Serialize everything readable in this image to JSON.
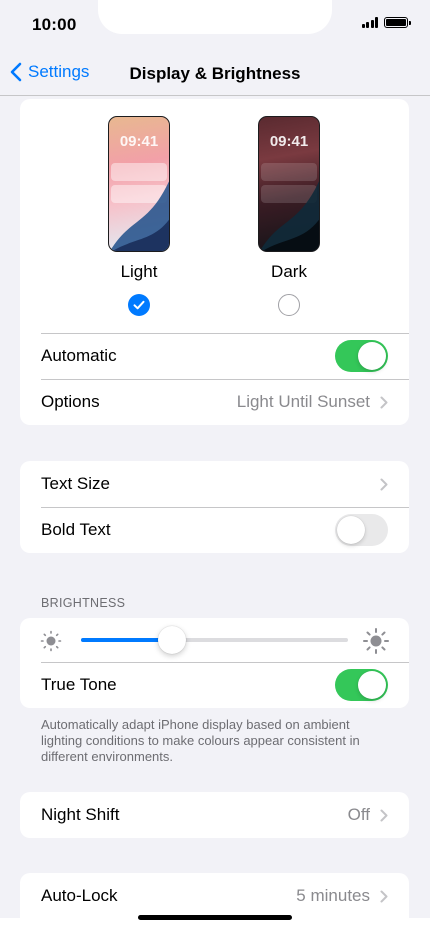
{
  "status_bar": {
    "time": "10:00"
  },
  "nav": {
    "back_label": "Settings",
    "title": "Display & Brightness"
  },
  "appearance": {
    "light": {
      "preview_time": "09:41",
      "label": "Light",
      "selected": true
    },
    "dark": {
      "preview_time": "09:41",
      "label": "Dark",
      "selected": false
    },
    "automatic": {
      "label": "Automatic",
      "on": true
    },
    "options": {
      "label": "Options",
      "value": "Light Until Sunset"
    }
  },
  "text": {
    "text_size": {
      "label": "Text Size"
    },
    "bold_text": {
      "label": "Bold Text",
      "on": false
    }
  },
  "brightness": {
    "header": "BRIGHTNESS",
    "level": 0.34,
    "true_tone": {
      "label": "True Tone",
      "on": true
    },
    "footer": "Automatically adapt iPhone display based on ambient lighting conditions to make colours appear consistent in different environments."
  },
  "night_shift": {
    "label": "Night Shift",
    "value": "Off"
  },
  "auto_lock": {
    "label": "Auto-Lock",
    "value": "5 minutes"
  },
  "colors": {
    "accent": "#007aff",
    "toggle_on": "#34c759",
    "toggle_off": "#e9e9ea",
    "background": "#f2f2f7"
  }
}
